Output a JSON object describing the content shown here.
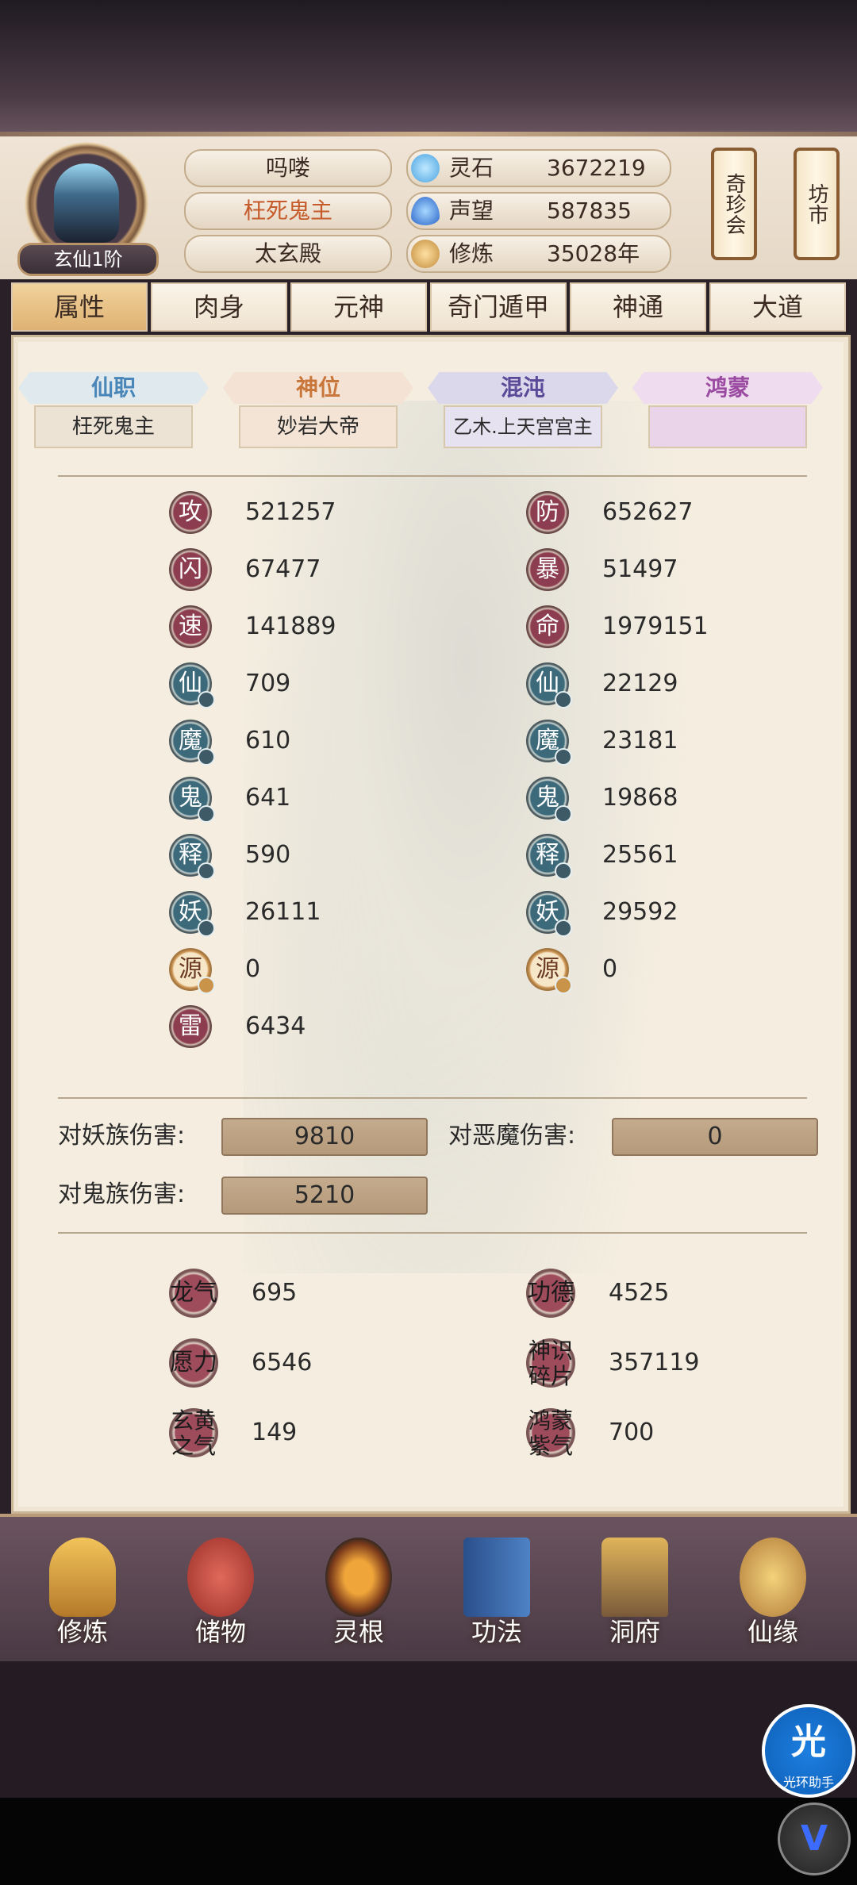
{
  "player": {
    "rank": "玄仙1阶",
    "names": [
      "吗喽",
      "枉死鬼主",
      "太玄殿"
    ]
  },
  "resources": [
    {
      "icon": "spirit-stone-icon",
      "label": "灵石",
      "value": "3672219"
    },
    {
      "icon": "reputation-icon",
      "label": "声望",
      "value": "587835"
    },
    {
      "icon": "cultivation-icon",
      "label": "修炼",
      "value": "35028年"
    }
  ],
  "side_buttons": [
    "奇珍会",
    "坊市"
  ],
  "tabs": [
    "属性",
    "肉身",
    "元神",
    "奇门遁甲",
    "神通",
    "大道"
  ],
  "honors": [
    {
      "title": "仙职",
      "value": "枉死鬼主",
      "color": "#4a86b8"
    },
    {
      "title": "神位",
      "value": "妙岩大帝",
      "color": "#c9763a"
    },
    {
      "title": "混沌",
      "value": "乙木.上天宫宫主",
      "color": "#6a5aa8"
    },
    {
      "title": "鸿蒙",
      "value": "",
      "color": "#9a4aa0"
    }
  ],
  "stats_left": [
    {
      "char": "攻",
      "value": "521257"
    },
    {
      "char": "闪",
      "value": "67477"
    },
    {
      "char": "速",
      "value": "141889"
    },
    {
      "char": "仙",
      "value": "709"
    },
    {
      "char": "魔",
      "value": "610"
    },
    {
      "char": "鬼",
      "value": "641"
    },
    {
      "char": "释",
      "value": "590"
    },
    {
      "char": "妖",
      "value": "26111"
    },
    {
      "char": "源",
      "value": "0"
    },
    {
      "char": "雷",
      "value": "6434"
    }
  ],
  "stats_right": [
    {
      "char": "防",
      "value": "652627"
    },
    {
      "char": "暴",
      "value": "51497"
    },
    {
      "char": "命",
      "value": "1979151"
    },
    {
      "char": "仙",
      "value": "22129"
    },
    {
      "char": "魔",
      "value": "23181"
    },
    {
      "char": "鬼",
      "value": "19868"
    },
    {
      "char": "释",
      "value": "25561"
    },
    {
      "char": "妖",
      "value": "29592"
    },
    {
      "char": "源",
      "value": "0"
    }
  ],
  "damage": [
    {
      "label": "对妖族伤害:",
      "value": "9810"
    },
    {
      "label": "对恶魔伤害:",
      "value": "0"
    },
    {
      "label": "对鬼族伤害:",
      "value": "5210"
    }
  ],
  "extras": [
    {
      "label": "龙气",
      "value": "695"
    },
    {
      "label": "功德",
      "value": "4525"
    },
    {
      "label": "愿力",
      "value": "6546"
    },
    {
      "label": "神识碎片",
      "value": "357119"
    },
    {
      "label": "玄黄之气",
      "value": "149"
    },
    {
      "label": "鸿蒙紫气",
      "value": "700"
    }
  ],
  "bottom_nav": [
    "修炼",
    "储物",
    "灵根",
    "功法",
    "洞府",
    "仙缘"
  ],
  "float_button": {
    "main": "光",
    "sub": "光环助手",
    "v": "V"
  }
}
